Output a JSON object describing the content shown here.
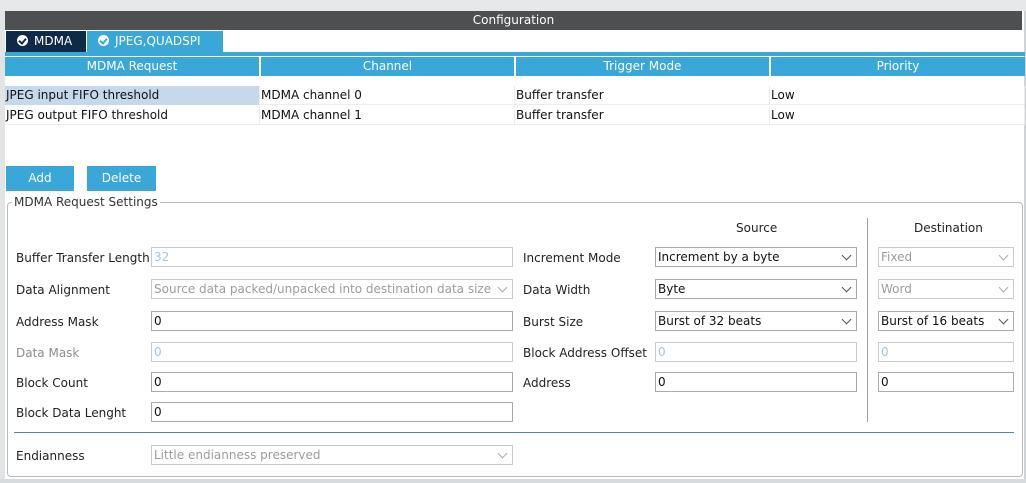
{
  "window": {
    "title": "Configuration"
  },
  "tabs": [
    {
      "label": "MDMA",
      "active": true
    },
    {
      "label": "JPEG,QUADSPI",
      "active": false
    }
  ],
  "table": {
    "columns": [
      "MDMA Request",
      "Channel",
      "Trigger Mode",
      "Priority"
    ],
    "rows": [
      {
        "request": "JPEG input FIFO threshold",
        "channel": "MDMA channel 0",
        "trigger": "Buffer transfer",
        "priority": "Low",
        "selected": true
      },
      {
        "request": "JPEG output FIFO threshold",
        "channel": "MDMA channel 1",
        "trigger": "Buffer transfer",
        "priority": "Low",
        "selected": false
      }
    ]
  },
  "buttons": {
    "add": "Add",
    "delete": "Delete"
  },
  "settings": {
    "title": "MDMA Request Settings",
    "source_header": "Source",
    "destination_header": "Destination",
    "left": {
      "buffer_transfer_length": {
        "label": "Buffer Transfer Length",
        "value": "32"
      },
      "data_alignment": {
        "label": "Data Alignment",
        "value": "Source data packed/unpacked into destination data size"
      },
      "address_mask": {
        "label": "Address Mask",
        "value": "0"
      },
      "data_mask": {
        "label": "Data Mask",
        "value": "0"
      },
      "block_count": {
        "label": "Block Count",
        "value": "0"
      },
      "block_data_length": {
        "label": "Block Data Lenght",
        "value": "0"
      }
    },
    "middle": {
      "increment_mode": {
        "label": "Increment Mode",
        "source": "Increment by a byte",
        "destination": "Fixed"
      },
      "data_width": {
        "label": "Data Width",
        "source": "Byte",
        "destination": "Word"
      },
      "burst_size": {
        "label": "Burst Size",
        "source": "Burst of 32 beats",
        "destination": "Burst of 16 beats"
      },
      "block_address_offset": {
        "label": "Block Address Offset",
        "source": "0",
        "destination": "0"
      },
      "address": {
        "label": "Address",
        "source": "0",
        "destination": "0"
      }
    },
    "endianness": {
      "label": "Endianness",
      "value": "Little endianness preserved"
    }
  }
}
